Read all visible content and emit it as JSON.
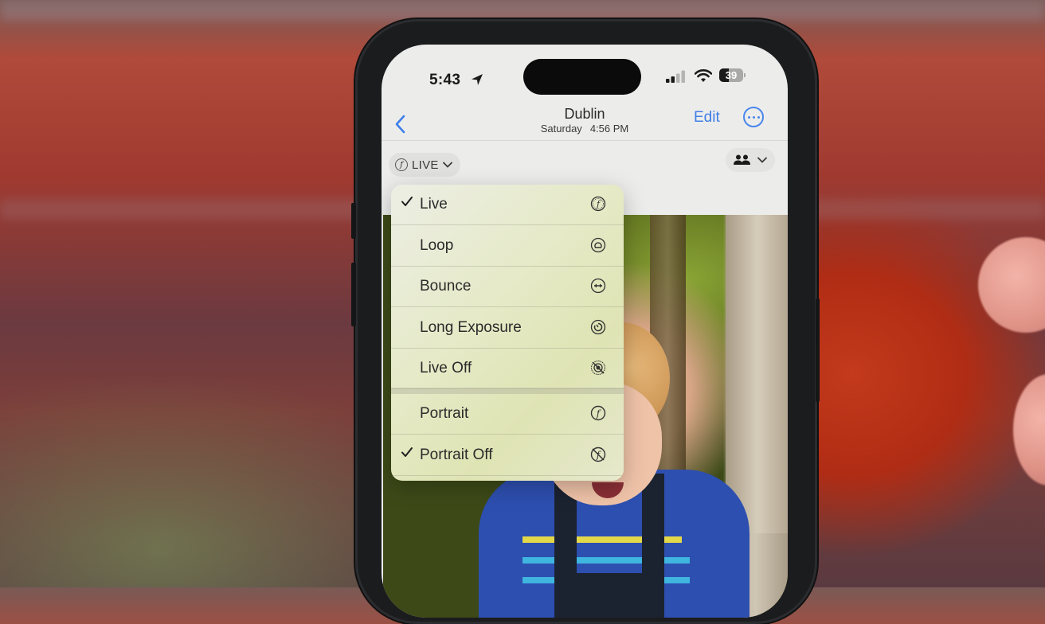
{
  "status_bar": {
    "time": "5:43",
    "location_icon": "location-arrow-icon",
    "signal_icon": "cellular-signal-icon",
    "signal_bars_active": 2,
    "signal_bars_total": 4,
    "wifi_icon": "wifi-icon",
    "battery_percent": "39",
    "battery_level": 0.39
  },
  "nav": {
    "back_icon": "chevron-left-icon",
    "title": "Dublin",
    "subtitle_day": "Saturday",
    "subtitle_time": "4:56 PM",
    "edit_label": "Edit",
    "more_icon": "ellipsis-circle-icon",
    "accent_color": "#3f7ee8"
  },
  "toolbar": {
    "live_label": "LIVE",
    "live_icon": "live-photo-icon",
    "people_icon": "people-icon"
  },
  "menu": {
    "group1": [
      {
        "label": "Live",
        "icon": "live-photo-icon",
        "checked": true
      },
      {
        "label": "Loop",
        "icon": "loop-icon",
        "checked": false
      },
      {
        "label": "Bounce",
        "icon": "bounce-icon",
        "checked": false
      },
      {
        "label": "Long Exposure",
        "icon": "long-exposure-icon",
        "checked": false
      },
      {
        "label": "Live Off",
        "icon": "live-off-icon",
        "checked": false
      }
    ],
    "group2": [
      {
        "label": "Portrait",
        "icon": "portrait-icon",
        "checked": false
      },
      {
        "label": "Portrait Off",
        "icon": "portrait-off-icon",
        "checked": true
      }
    ]
  }
}
